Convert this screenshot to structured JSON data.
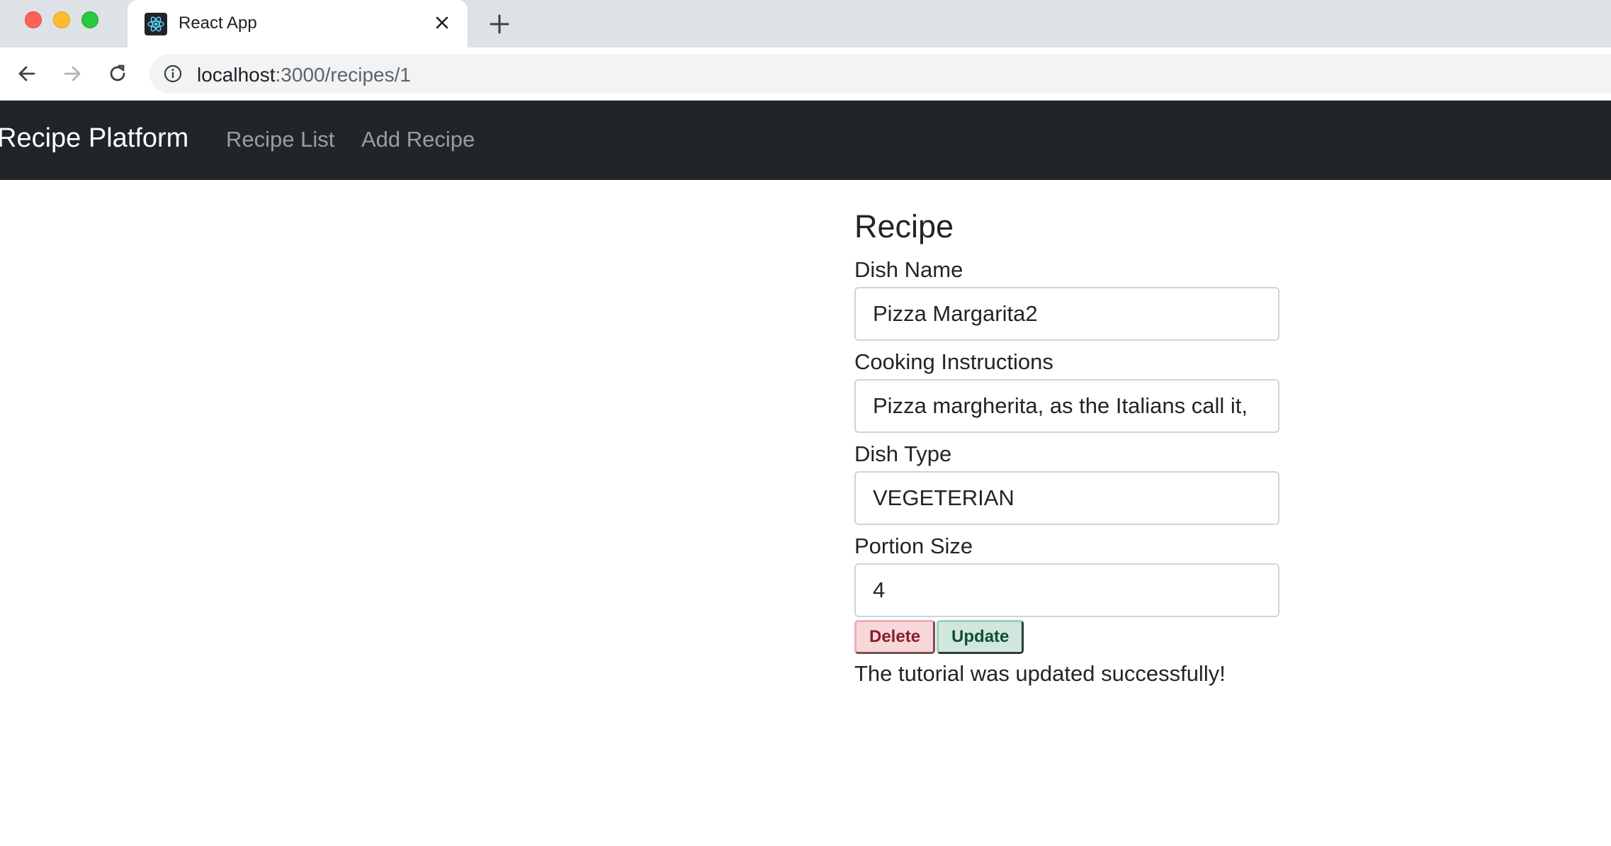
{
  "browser": {
    "tab_title": "React App",
    "url_host": "localhost",
    "url_rest": ":3000/recipes/1"
  },
  "navbar": {
    "brand": "Recipe Platform",
    "links": [
      "Recipe List",
      "Add Recipe"
    ]
  },
  "recipe": {
    "heading": "Recipe",
    "fields": [
      {
        "label": "Dish Name",
        "value": "Pizza Margarita2"
      },
      {
        "label": "Cooking Instructions",
        "value": "Pizza margherita, as the Italians call it,"
      },
      {
        "label": "Dish Type",
        "value": "VEGETERIAN"
      },
      {
        "label": "Portion Size",
        "value": "4"
      }
    ],
    "delete_label": "Delete",
    "update_label": "Update",
    "message": "The tutorial was updated successfully!"
  },
  "colors": {
    "navbar_bg": "#212529",
    "delete_bg": "#f8d7da",
    "update_bg": "#d1e7dd"
  },
  "icons": [
    "react-logo-icon",
    "close-icon",
    "plus-icon",
    "back-arrow-icon",
    "forward-arrow-icon",
    "reload-icon",
    "info-icon"
  ]
}
